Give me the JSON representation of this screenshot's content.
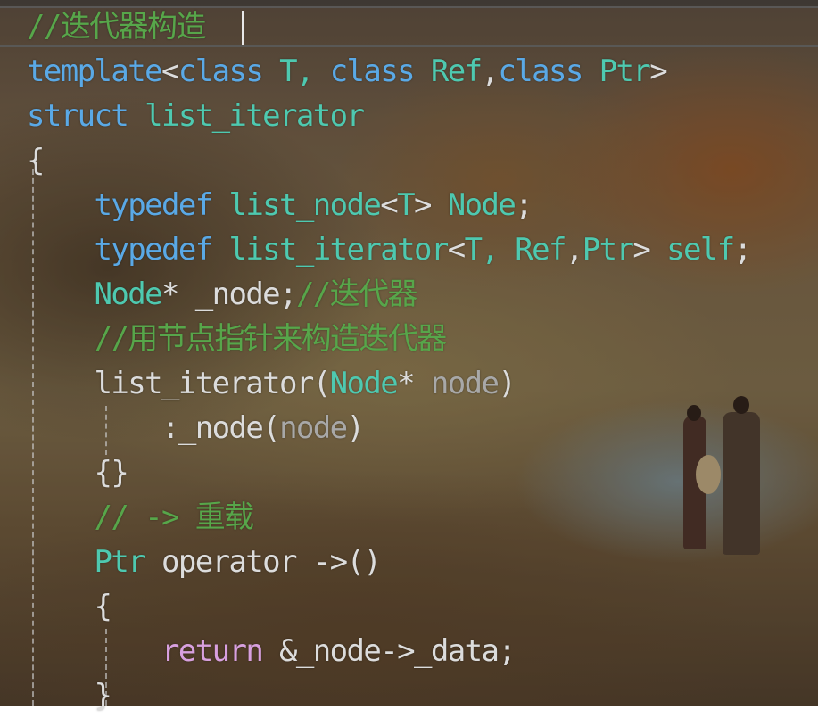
{
  "editor": {
    "lines": [
      {
        "indent": "",
        "tokens": [
          {
            "t": "//迭代器构造",
            "c": "cm"
          }
        ]
      },
      {
        "indent": "",
        "tokens": [
          {
            "t": "template",
            "c": "kw"
          },
          {
            "t": "<",
            "c": "tx"
          },
          {
            "t": "class",
            "c": "kw"
          },
          {
            "t": " T, ",
            "c": "ty"
          },
          {
            "t": "class",
            "c": "kw"
          },
          {
            "t": " Ref",
            "c": "ty"
          },
          {
            "t": ",",
            "c": "tx"
          },
          {
            "t": "class",
            "c": "kw"
          },
          {
            "t": " Ptr",
            "c": "ty"
          },
          {
            "t": ">",
            "c": "tx"
          }
        ]
      },
      {
        "indent": "",
        "tokens": [
          {
            "t": "struct",
            "c": "kw"
          },
          {
            "t": " list_iterator",
            "c": "ty"
          }
        ]
      },
      {
        "indent": "",
        "tokens": [
          {
            "t": "{",
            "c": "tx"
          }
        ]
      },
      {
        "indent": "    ",
        "tokens": [
          {
            "t": "typedef",
            "c": "kw"
          },
          {
            "t": " list_node",
            "c": "ty"
          },
          {
            "t": "<",
            "c": "tx"
          },
          {
            "t": "T",
            "c": "ty"
          },
          {
            "t": "> ",
            "c": "tx"
          },
          {
            "t": "Node",
            "c": "ty"
          },
          {
            "t": ";",
            "c": "tx"
          }
        ]
      },
      {
        "indent": "    ",
        "tokens": [
          {
            "t": "typedef",
            "c": "kw"
          },
          {
            "t": " list_iterator",
            "c": "ty"
          },
          {
            "t": "<",
            "c": "tx"
          },
          {
            "t": "T, Ref",
            "c": "ty"
          },
          {
            "t": ",",
            "c": "tx"
          },
          {
            "t": "Ptr",
            "c": "ty"
          },
          {
            "t": "> ",
            "c": "tx"
          },
          {
            "t": "self",
            "c": "ty"
          },
          {
            "t": ";",
            "c": "tx"
          }
        ]
      },
      {
        "indent": "    ",
        "tokens": [
          {
            "t": "Node",
            "c": "ty"
          },
          {
            "t": "* _node;",
            "c": "tx"
          },
          {
            "t": "//迭代器",
            "c": "cm"
          }
        ]
      },
      {
        "indent": "    ",
        "tokens": [
          {
            "t": "//用节点指针来构造迭代器",
            "c": "cm"
          }
        ]
      },
      {
        "indent": "    ",
        "tokens": [
          {
            "t": "list_iterator(",
            "c": "tx"
          },
          {
            "t": "Node",
            "c": "ty"
          },
          {
            "t": "* ",
            "c": "tx"
          },
          {
            "t": "node",
            "c": "pm"
          },
          {
            "t": ")",
            "c": "tx"
          }
        ]
      },
      {
        "indent": "        ",
        "tokens": [
          {
            "t": ":_node(",
            "c": "tx"
          },
          {
            "t": "node",
            "c": "pm"
          },
          {
            "t": ")",
            "c": "tx"
          }
        ]
      },
      {
        "indent": "    ",
        "tokens": [
          {
            "t": "{}",
            "c": "tx"
          }
        ]
      },
      {
        "indent": "    ",
        "tokens": [
          {
            "t": "// -> 重载",
            "c": "cm"
          }
        ]
      },
      {
        "indent": "    ",
        "tokens": [
          {
            "t": "Ptr",
            "c": "ty"
          },
          {
            "t": " operator ->()",
            "c": "tx"
          }
        ]
      },
      {
        "indent": "    ",
        "tokens": [
          {
            "t": "{",
            "c": "tx"
          }
        ]
      },
      {
        "indent": "        ",
        "tokens": [
          {
            "t": "return",
            "c": "rt"
          },
          {
            "t": " &_node->_data;",
            "c": "tx"
          }
        ]
      },
      {
        "indent": "    ",
        "tokens": [
          {
            "t": "}",
            "c": "tx"
          }
        ]
      }
    ]
  },
  "colors": {
    "keyword": "#5aa9e6",
    "type": "#4ec9b0",
    "comment": "#57a64a",
    "text": "#dcdcdc",
    "parameter": "#a8a8a8",
    "control": "#d8a0df"
  },
  "background": {
    "description_icon": "landscape-wallpaper"
  }
}
